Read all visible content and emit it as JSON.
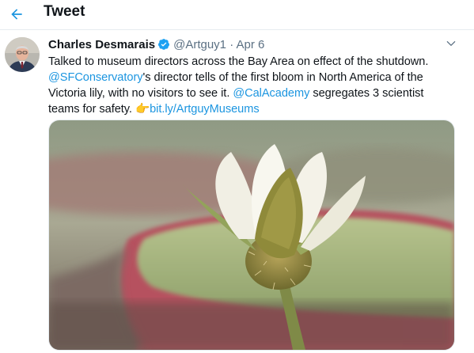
{
  "header": {
    "title": "Tweet",
    "back_icon": "arrow-left-icon"
  },
  "tweet": {
    "author": {
      "display_name": "Charles Desmarais",
      "handle": "@Artguy1",
      "verified": true
    },
    "separator": "·",
    "date": "Apr 6",
    "text": {
      "part1": "Talked to museum directors across the Bay Area on effect of the shutdown. ",
      "mention1": "@SFConservatory",
      "part2": "'s director tells of the first bloom in North America of the Victoria lily, with no visitors to see it. ",
      "mention2": "@CalAcademy",
      "part3": " segregates 3 scientist teams for safety. ",
      "emoji": "👉",
      "link": "bit.ly/ArtguyMuseums"
    },
    "media_description": "Victoria water lily bud with white petals opening above red-rimmed lily pads"
  },
  "colors": {
    "accent": "#1b95e0",
    "text": "#0f1419",
    "muted": "#5b7083",
    "verified": "#1da1f2"
  }
}
